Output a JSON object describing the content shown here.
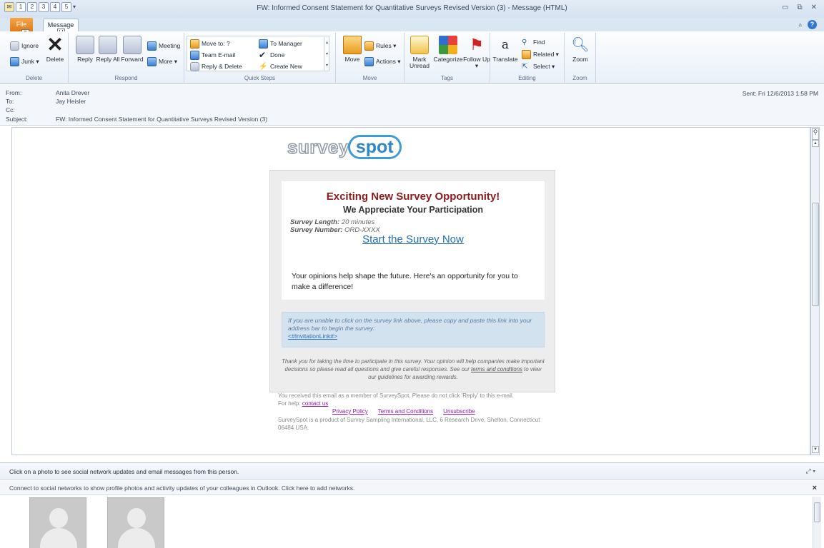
{
  "window": {
    "title": "FW: Informed Consent Statement for Quantitative Surveys Revised Version (3)  -  Message (HTML)",
    "qat_keytips": [
      "1",
      "2",
      "3",
      "4",
      "5"
    ]
  },
  "tabs": {
    "file_label": "File",
    "file_keytip": "F",
    "message_label": "Message",
    "message_keytip": "H"
  },
  "ribbon": {
    "delete": {
      "ignore": "Ignore",
      "junk": "Junk ▾",
      "delete": "Delete",
      "group": "Delete"
    },
    "respond": {
      "reply": "Reply",
      "reply_all": "Reply All",
      "forward": "Forward",
      "meeting": "Meeting",
      "more": "More ▾",
      "group": "Respond"
    },
    "quick_steps": {
      "move_to": "Move to: ?",
      "team_email": "Team E-mail",
      "reply_delete": "Reply & Delete",
      "to_manager": "To Manager",
      "done": "Done",
      "create_new": "Create New",
      "group": "Quick Steps"
    },
    "move": {
      "move": "Move",
      "rules": "Rules ▾",
      "actions": "Actions ▾",
      "group": "Move"
    },
    "tags": {
      "mark_unread": "Mark Unread",
      "categorize": "Categorize",
      "follow_up": "Follow Up ▾",
      "group": "Tags"
    },
    "editing": {
      "translate": "Translate",
      "find": "Find",
      "related": "Related ▾",
      "select": "Select ▾",
      "group": "Editing"
    },
    "zoom": {
      "zoom": "Zoom",
      "group": "Zoom"
    }
  },
  "header": {
    "from_label": "From:",
    "from": "Anita Drever",
    "to_label": "To:",
    "to": "Jay Heisler",
    "cc_label": "Cc:",
    "cc": "",
    "subject_label": "Subject:",
    "subject": "FW: Informed Consent Statement for Quantitative Surveys Revised Version (3)",
    "sent": "Sent:   Fri 12/6/2013 1:58 PM"
  },
  "email": {
    "logo_part1": "survey",
    "logo_part2": "spot",
    "headline": "Exciting New Survey Opportunity!",
    "subheadline": "We Appreciate Your Participation",
    "length_label": "Survey Length:",
    "length_value": "20  minutes",
    "number_label": "Survey Number:",
    "number_value": "ORD-XXXX",
    "cta": "Start the Survey Now",
    "paragraph": "Your opinions help shape the future. Here's an opportunity for you to make a difference!",
    "help_text": "If you are unable to click on the survey link above, please copy and paste this link into your address bar to begin the survey:",
    "invitation_link": "<#InvitationLink#>",
    "thanks_text": "Thank you for taking the time to participate in this survey. Your opinion will help companies make important decisions so please read all questions and give careful responses. See our",
    "terms_link": "terms and conditions",
    "thanks_end": "to view our guidelines for awarding rewards.",
    "footer_line": "You received this email as a member of SurveySpot. Please do not click 'Reply' to this e-mail.",
    "for_help": "For help:",
    "contact_us": "contact us",
    "privacy": "Privacy Policy",
    "terms": "Terms and Conditions",
    "unsubscribe": "Unsubscribe",
    "company": "SurveySpot is a product of Survey Sampling International, LLC, 6 Research Drive, Shelton, Connecticut 06484 USA."
  },
  "people_pane": {
    "hint": "Click on a photo to see social network updates and email messages from this person.",
    "connect": "Connect to social networks to show profile photos and activity updates of your colleagues in Outlook. Click here to add networks."
  }
}
